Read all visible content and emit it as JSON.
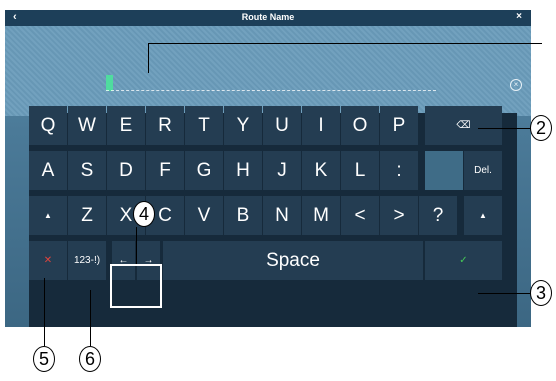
{
  "dialog": {
    "title": "Route Name",
    "back_glyph": "‹",
    "close_glyph": "×",
    "clear_glyph": "×"
  },
  "keyboard": {
    "row1": [
      "Q",
      "W",
      "E",
      "R",
      "T",
      "Y",
      "U",
      "I",
      "O",
      "P"
    ],
    "row2": [
      "A",
      "S",
      "D",
      "F",
      "G",
      "H",
      "J",
      "K",
      "L",
      ":"
    ],
    "del_label": "Del.",
    "row3": [
      "Z",
      "X",
      "C",
      "V",
      "B",
      "N",
      "M",
      "<",
      ">",
      "?"
    ],
    "shift_glyph": "▲",
    "backspace_glyph": "⌫",
    "cancel_glyph": "✕",
    "mode_label": "123-!)",
    "left_arrow": "←",
    "right_arrow": "→",
    "space_label": "Space",
    "confirm_glyph": "✓"
  },
  "callouts": [
    "2",
    "3",
    "4",
    "5",
    "6"
  ],
  "colors": {
    "key_bg": "#243d52",
    "keyboard_bg": "#162a3b",
    "title_bg": "#1d3f59",
    "caret": "#4fdc9f",
    "cancel": "#e0443e",
    "confirm": "#45c857"
  }
}
